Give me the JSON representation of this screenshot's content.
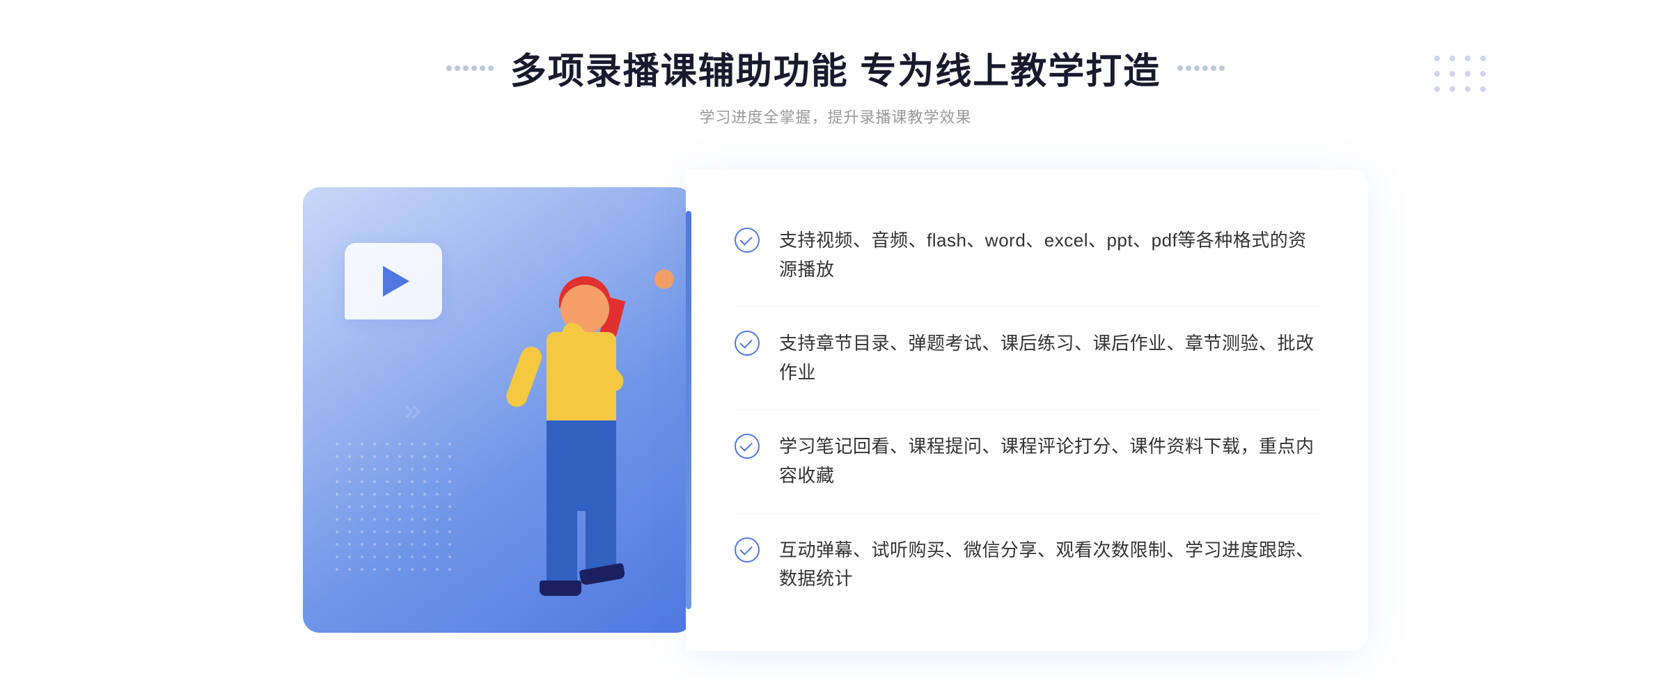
{
  "header": {
    "title": "多项录播课辅助功能 专为线上教学打造",
    "subtitle": "学习进度全掌握，提升录播课教学效果",
    "dots_left": "decorative",
    "dots_right": "decorative"
  },
  "features": [
    {
      "id": 1,
      "text": "支持视频、音频、flash、word、excel、ppt、pdf等各种格式的资源播放"
    },
    {
      "id": 2,
      "text": "支持章节目录、弹题考试、课后练习、课后作业、章节测验、批改作业"
    },
    {
      "id": 3,
      "text": "学习笔记回看、课程提问、课程评论打分、课件资料下载，重点内容收藏"
    },
    {
      "id": 4,
      "text": "互动弹幕、试听购买、微信分享、观看次数限制、学习进度跟踪、数据统计"
    }
  ],
  "colors": {
    "accent": "#5078e0",
    "title": "#1a1a2e",
    "subtitle": "#999999",
    "text": "#333333",
    "card_bg": "#ffffff"
  }
}
